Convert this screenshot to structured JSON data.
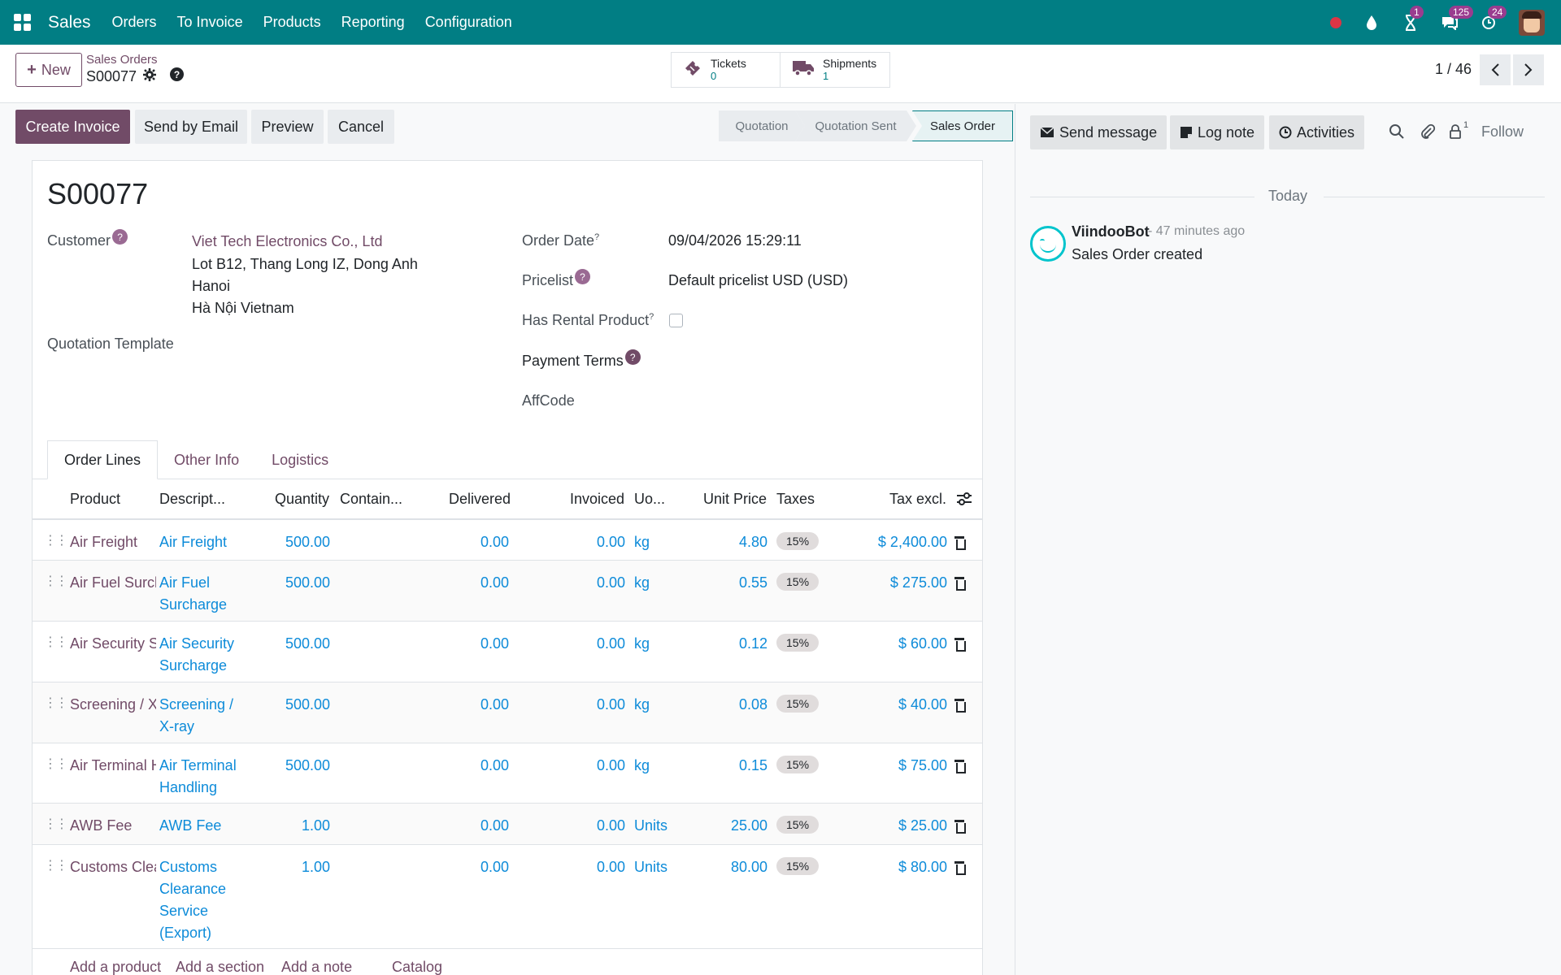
{
  "nav": {
    "app_name": "Sales",
    "menus": [
      "Orders",
      "To Invoice",
      "Products",
      "Reporting",
      "Configuration"
    ],
    "badges": {
      "activities": "1",
      "messages": "125",
      "updates": "24"
    }
  },
  "control": {
    "new_label": "New",
    "breadcrumb_parent": "Sales Orders",
    "breadcrumb_current": "S00077",
    "smart_buttons": [
      {
        "label": "Tickets",
        "value": "0",
        "icon": "ticket-icon"
      },
      {
        "label": "Shipments",
        "value": "1",
        "icon": "truck-icon"
      }
    ],
    "pager": "1 / 46"
  },
  "statusbar": {
    "buttons": [
      "Create Invoice",
      "Send by Email",
      "Preview",
      "Cancel"
    ],
    "stages": [
      "Quotation",
      "Quotation Sent",
      "Sales Order"
    ],
    "active_stage": "Sales Order"
  },
  "form": {
    "title": "S00077",
    "customer_label": "Customer",
    "customer_name": "Viet Tech Electronics Co., Ltd",
    "customer_addr1": "Lot B12, Thang Long IZ, Dong Anh",
    "customer_addr2": "Hanoi",
    "customer_addr3": "Hà Nội Vietnam",
    "template_label": "Quotation Template",
    "order_date_label": "Order Date",
    "order_date": "09/04/2026 15:29:11",
    "pricelist_label": "Pricelist",
    "pricelist": "Default pricelist USD (USD)",
    "rental_label": "Has Rental Product",
    "payment_terms_label": "Payment Terms",
    "affcode_label": "AffCode",
    "help_q": "?"
  },
  "tabs": [
    "Order Lines",
    "Other Info",
    "Logistics"
  ],
  "table": {
    "headers": [
      "Product",
      "Descript...",
      "Quantity",
      "Contain...",
      "Delivered",
      "Invoiced",
      "Uo...",
      "Unit Price",
      "Taxes",
      "Tax excl."
    ],
    "rows": [
      {
        "product": "Air Freight",
        "desc": "Air Freight",
        "qty": "500.00",
        "delivered": "0.00",
        "invoiced": "0.00",
        "uom": "kg",
        "price": "4.80",
        "tax": "15%",
        "total": "$ 2,400.00"
      },
      {
        "product": "Air Fuel Surcharge",
        "desc": "Air Fuel Surcharge",
        "qty": "500.00",
        "delivered": "0.00",
        "invoiced": "0.00",
        "uom": "kg",
        "price": "0.55",
        "tax": "15%",
        "total": "$ 275.00"
      },
      {
        "product": "Air Security Surcharge",
        "desc": "Air Security Surcharge",
        "qty": "500.00",
        "delivered": "0.00",
        "invoiced": "0.00",
        "uom": "kg",
        "price": "0.12",
        "tax": "15%",
        "total": "$ 60.00"
      },
      {
        "product": "Screening / X-ray",
        "desc": "Screening / X-ray",
        "qty": "500.00",
        "delivered": "0.00",
        "invoiced": "0.00",
        "uom": "kg",
        "price": "0.08",
        "tax": "15%",
        "total": "$ 40.00"
      },
      {
        "product": "Air Terminal Handling",
        "desc": "Air Terminal Handling",
        "qty": "500.00",
        "delivered": "0.00",
        "invoiced": "0.00",
        "uom": "kg",
        "price": "0.15",
        "tax": "15%",
        "total": "$ 75.00"
      },
      {
        "product": "AWB Fee",
        "desc": "AWB Fee",
        "qty": "1.00",
        "delivered": "0.00",
        "invoiced": "0.00",
        "uom": "Units",
        "price": "25.00",
        "tax": "15%",
        "total": "$ 25.00"
      },
      {
        "product": "Customs Clearance Service (Export)",
        "desc": "Customs Clearance Service (Export)",
        "qty": "1.00",
        "delivered": "0.00",
        "invoiced": "0.00",
        "uom": "Units",
        "price": "80.00",
        "tax": "15%",
        "total": "$ 80.00"
      }
    ],
    "add_links": [
      "Add a product",
      "Add a section",
      "Add a note",
      "Catalog"
    ]
  },
  "chatter": {
    "send_message": "Send message",
    "log_note": "Log note",
    "activities": "Activities",
    "followers_count": "1",
    "follow": "Follow",
    "today": "Today",
    "author": "ViindooBot",
    "ago": "- 47 minutes ago",
    "message": "Sales Order created"
  }
}
